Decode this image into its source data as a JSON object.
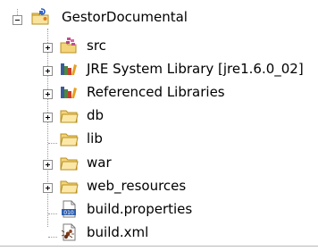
{
  "tree": {
    "root": {
      "label": "GestorDocumental",
      "icon": "java-project-icon",
      "expanded": true
    },
    "children": [
      {
        "label": "src",
        "icon": "source-package-icon",
        "expandable": true
      },
      {
        "label": "JRE System Library [jre1.6.0_02]",
        "icon": "library-icon",
        "expandable": true
      },
      {
        "label": "Referenced Libraries",
        "icon": "library-icon",
        "expandable": true
      },
      {
        "label": "db",
        "icon": "folder-icon",
        "expandable": true
      },
      {
        "label": "lib",
        "icon": "folder-icon",
        "expandable": false
      },
      {
        "label": "war",
        "icon": "folder-icon",
        "expandable": true
      },
      {
        "label": "web_resources",
        "icon": "folder-icon",
        "expandable": true
      },
      {
        "label": "build.properties",
        "icon": "properties-file-icon",
        "expandable": false
      },
      {
        "label": "build.xml",
        "icon": "ant-build-file-icon",
        "expandable": false
      }
    ]
  }
}
